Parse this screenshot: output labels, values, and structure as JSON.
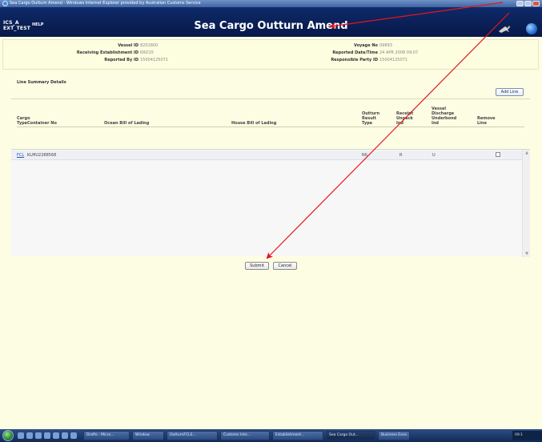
{
  "window": {
    "title": "Sea Cargo Outturn Amend - Windows Internet Explorer provided by Australian Customs Service"
  },
  "header": {
    "system_name_line1": "ICS_A",
    "system_name_line2": "EXT_TEST",
    "help_label": "HELP",
    "page_title": "Sea Cargo Outturn Amend"
  },
  "vessel_info": {
    "left": [
      {
        "label": "Vessel ID",
        "value": "8201800"
      },
      {
        "label": "Receiving Establishment ID",
        "value": "KRD15"
      },
      {
        "label": "Reported By ID",
        "value": "15004125071"
      }
    ],
    "right": [
      {
        "label": "Voyage No",
        "value": "09893"
      },
      {
        "label": "Reported Date/Time",
        "value": "24 APR 2008 09:07"
      },
      {
        "label": "Responsible Party ID",
        "value": "15004125071"
      }
    ]
  },
  "line_summary": {
    "title": "Line Summary Details",
    "add_line_label": "Add Line",
    "columns": {
      "cargo_type": [
        "Cargo",
        "Type"
      ],
      "container_no": "Container No",
      "ocean_bol": "Ocean Bill of Lading",
      "house_bol": "House Bill of Lading",
      "outturn": [
        "Outturn",
        "Result",
        "Type"
      ],
      "receipt": [
        "Receipt",
        "Unpack",
        "Ind"
      ],
      "vessel_discharge": [
        "Vessel",
        "Discharge",
        "Underbond",
        "Ind"
      ],
      "remove": [
        "Remove",
        "Line"
      ]
    },
    "rows": [
      {
        "cargo_type": "FCL",
        "container_no": "KLMU2288568",
        "ocean_bol": "",
        "house_bol": "",
        "outturn_result_type": "NIL",
        "receipt_unpack_ind": "R",
        "vessel_discharge_underbond_ind": "U",
        "remove_line": false
      }
    ]
  },
  "form": {
    "submit_label": "Submit",
    "cancel_label": "Cancel"
  },
  "taskbar": {
    "items": [
      {
        "label": "Drafts - Micro..."
      },
      {
        "label": "Window"
      },
      {
        "label": "OutturnFCLS..."
      },
      {
        "label": "Customs Inte..."
      },
      {
        "label": "Establishment..."
      },
      {
        "label": "Sea Cargo Out..."
      },
      {
        "label": "Business Exce..."
      }
    ],
    "clock": "09:1"
  },
  "colors": {
    "header_bg": "#0a1f55",
    "panel_bg": "#fdfde4",
    "annotation_arrow": "#e8141c",
    "link": "#1a55b8"
  }
}
